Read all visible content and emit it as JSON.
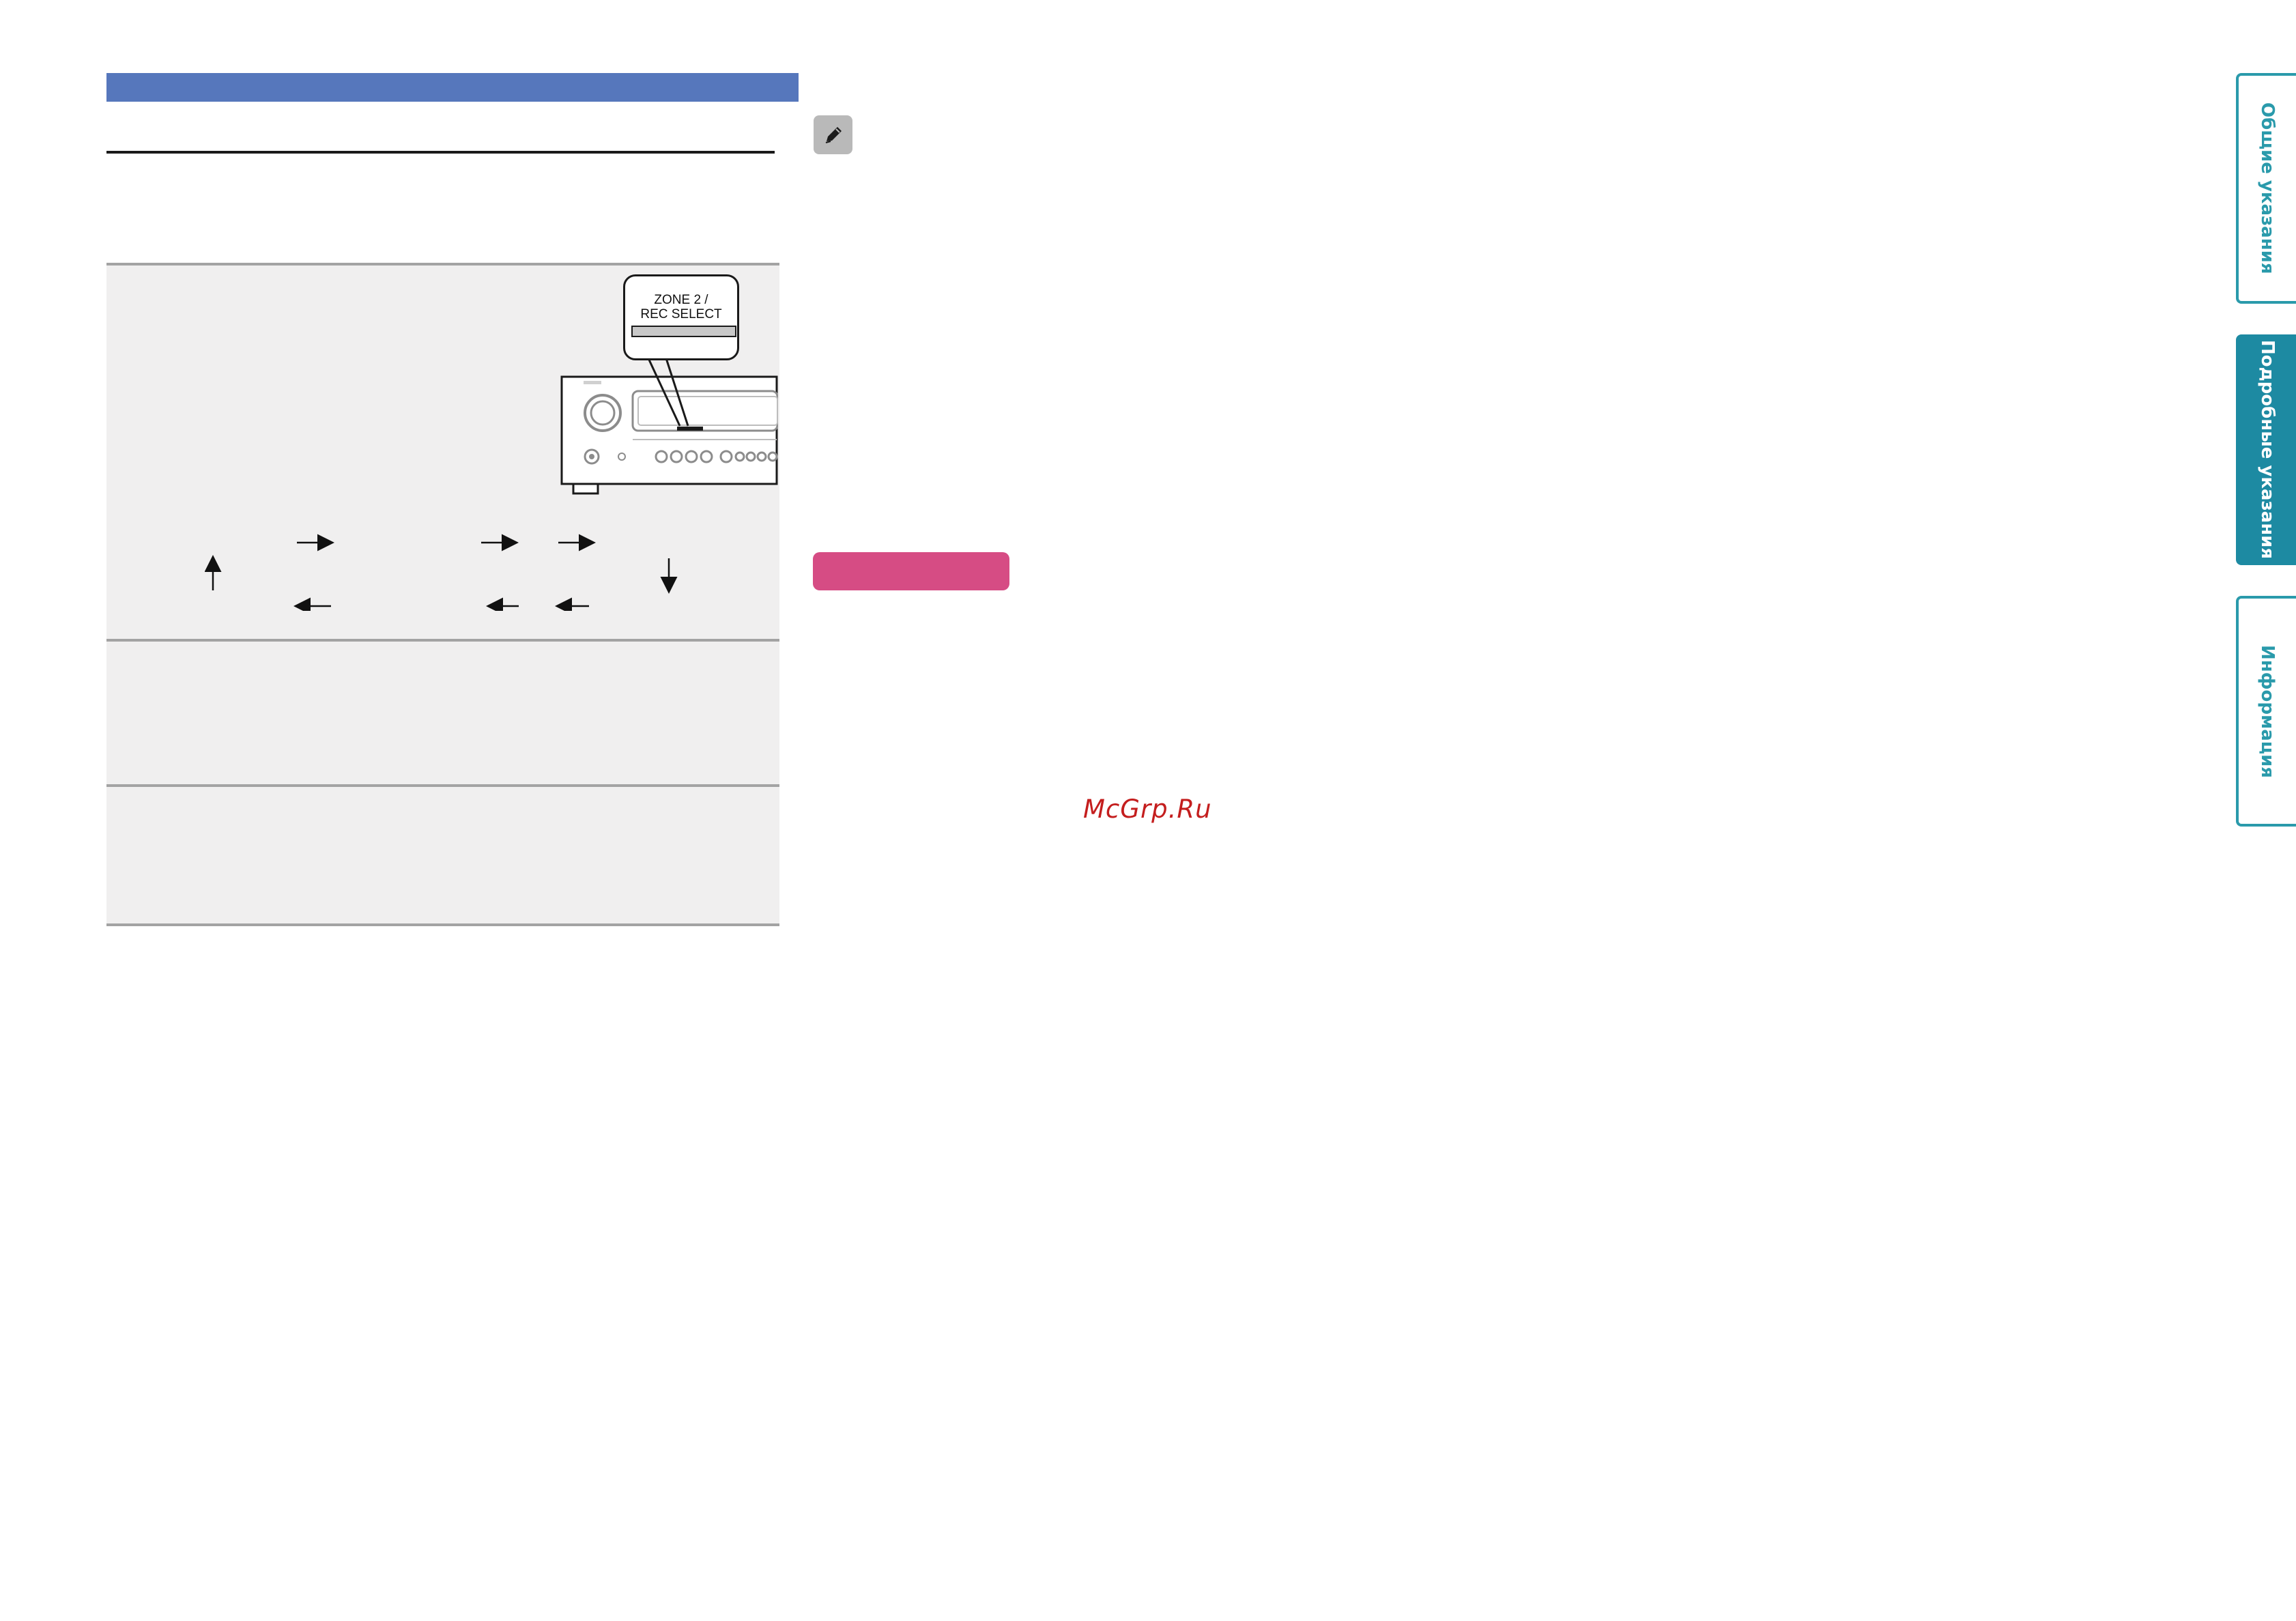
{
  "callout": {
    "label": "ZONE 2 /\nREC SELECT"
  },
  "watermark": {
    "text": "McGrp.Ru"
  },
  "side_tabs": [
    {
      "label": "Общие указания",
      "active": false
    },
    {
      "label": "Подробные указания",
      "active": true
    },
    {
      "label": "Информация",
      "active": false
    }
  ],
  "colors": {
    "header_bar": "#5677bc",
    "panel_bg": "#f0efef",
    "accent_pink": "#d64c84",
    "tab_teal": "#1d8aa2"
  },
  "icons": {
    "note": "pencil-icon",
    "flow_arrows": [
      "arrow-right-icon",
      "arrow-left-icon",
      "arrow-up-icon",
      "arrow-down-icon"
    ]
  }
}
